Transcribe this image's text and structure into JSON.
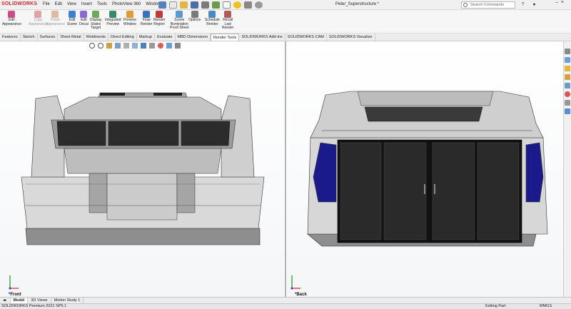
{
  "app": {
    "logo": "SOLIDWORKS",
    "document_title": "Peter_Superstructure *"
  },
  "menu": [
    "File",
    "Edit",
    "View",
    "Insert",
    "Tools",
    "PhotoView 360",
    "Window"
  ],
  "search": {
    "placeholder": "Search Commands"
  },
  "ribbon": [
    {
      "label": "Edit\nAppearance",
      "disabled": false
    },
    {
      "label": "Copy\nAppearance",
      "disabled": true
    },
    {
      "label": "Paste\nAppearance",
      "disabled": true
    },
    {
      "label": "Edit\nScene",
      "disabled": false
    },
    {
      "label": "Edit\nDecal",
      "disabled": false
    },
    {
      "label": "Display\nStates\nTarget",
      "disabled": false
    },
    {
      "label": "Integrated\nPreview",
      "disabled": false
    },
    {
      "label": "Preview\nWindow",
      "disabled": false
    },
    {
      "label": "Final\nRender",
      "disabled": false
    },
    {
      "label": "Render\nRegion",
      "disabled": false
    },
    {
      "label": "Scene\nIllumination\nProof Sheet",
      "disabled": false
    },
    {
      "label": "Options",
      "disabled": false
    },
    {
      "label": "Schedule\nRender",
      "disabled": false
    },
    {
      "label": "Recall\nLast\nRender",
      "disabled": false
    }
  ],
  "tabs": [
    "Features",
    "Sketch",
    "Surfaces",
    "Sheet Metal",
    "Weldments",
    "Direct Editing",
    "Markup",
    "Evaluate",
    "MBD Dimensions",
    "Render Tools",
    "SOLIDWORKS Add-Ins",
    "SOLIDWORKS CAM",
    "SOLIDWORKS Visualize"
  ],
  "active_tab": "Render Tools",
  "viewports": {
    "left_label": "*Front",
    "right_label": "*Back"
  },
  "bottom_tabs": [
    "Model",
    "3D Views",
    "Motion Study 1"
  ],
  "status": {
    "product": "SOLIDWORKS Premium 2021 SP5.1",
    "mode": "Editing Part",
    "units": "MMGS"
  },
  "colors": {
    "accent_red": "#d8262b",
    "window_blue": "#1a1a8a",
    "body_gray": "#d6d6d6"
  }
}
